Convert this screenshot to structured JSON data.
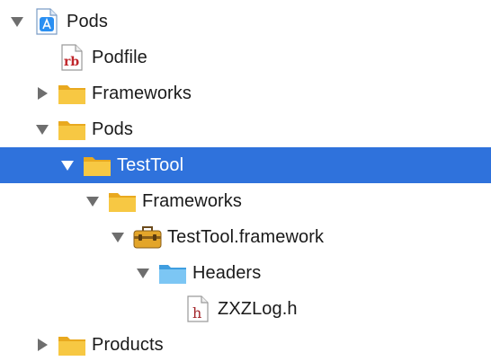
{
  "tree": {
    "items": [
      {
        "label": "Pods",
        "disclosure": "expanded",
        "icon": "project-icon"
      },
      {
        "label": "Podfile",
        "disclosure": "none",
        "icon": "ruby-file-icon"
      },
      {
        "label": "Frameworks",
        "disclosure": "collapsed",
        "icon": "folder-icon"
      },
      {
        "label": "Pods",
        "disclosure": "expanded",
        "icon": "folder-icon"
      },
      {
        "label": "TestTool",
        "disclosure": "expanded",
        "icon": "folder-icon",
        "selected": true
      },
      {
        "label": "Frameworks",
        "disclosure": "expanded",
        "icon": "folder-icon"
      },
      {
        "label": "TestTool.framework",
        "disclosure": "expanded",
        "icon": "framework-icon"
      },
      {
        "label": "Headers",
        "disclosure": "expanded",
        "icon": "blue-folder-icon"
      },
      {
        "label": "ZXZLog.h",
        "disclosure": "none",
        "icon": "header-file-icon"
      },
      {
        "label": "Products",
        "disclosure": "collapsed",
        "icon": "folder-icon"
      }
    ],
    "ruby_badge": "rb",
    "header_badge": "h"
  },
  "colors": {
    "selection": "#2f72dc",
    "folder": "#f2bf33",
    "blue_folder": "#5fb6ee",
    "disclosure": "#6e6e6e"
  }
}
